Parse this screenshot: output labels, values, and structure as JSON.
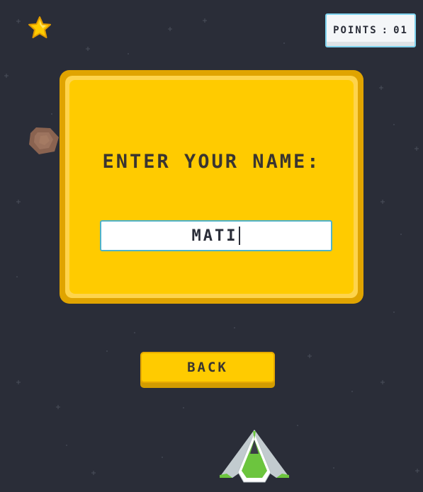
{
  "hud": {
    "points_label": "POINTS",
    "points_separator": ":",
    "points_value": "01"
  },
  "dialog": {
    "prompt": "ENTER YOUR NAME:",
    "name_value": "MATI"
  },
  "buttons": {
    "back_label": "BACK"
  },
  "icons": {
    "star": "star-icon",
    "asteroid": "asteroid-icon",
    "ship": "spaceship-icon"
  },
  "colors": {
    "background": "#2a2d38",
    "panel": "#ffcb00",
    "text": "#3a3530",
    "ship_accent": "#6cc53e"
  }
}
